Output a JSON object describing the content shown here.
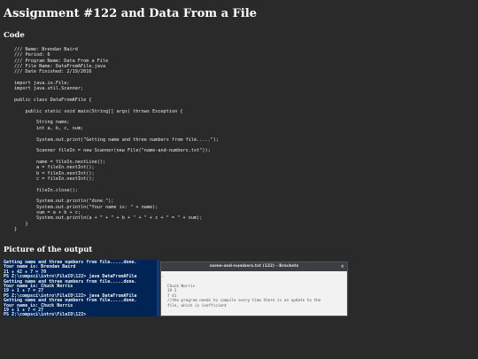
{
  "page": {
    "title": "Assignment #122 and Data From a File"
  },
  "sections": {
    "code_heading": "Code",
    "output_heading": "Picture of the output"
  },
  "code": {
    "lines": [
      "/// Name: Brendan Baird",
      "/// Period: 6",
      "/// Program Name: Data From a File",
      "/// File Name: DataFromAFile.java",
      "/// Date Finished: 2/19/2016",
      "",
      "import java.io.File;",
      "import java.util.Scanner;",
      "",
      "public class DataFromAFile {",
      "",
      "    public static void main(String[] args) throws Exception {",
      "",
      "        String name;",
      "        int a, b, c, sum;",
      "",
      "        System.out.print(\"Getting name and three numbers from file.....\");",
      "",
      "        Scanner fileIn = new Scanner(new File(\"name-and-numbers.txt\"));",
      "",
      "        name = fileIn.nextLine();",
      "        a = fileIn.nextInt();",
      "        b = fileIn.nextInt();",
      "        c = fileIn.nextInt();",
      "",
      "        fileIn.close();",
      "",
      "        System.out.println(\"done.\");",
      "        System.out.println(\"Your name is: \" + name);",
      "        sum = a + b + c;",
      "        System.out.println(a + \" + \" + b + \" + \" + c + \" = \" + sum);",
      "    }",
      "}"
    ]
  },
  "terminal": {
    "lines": [
      "Getting name and three numbers from file.....done.",
      "Your name is: Brendan Baird",
      "21 + 42 + 7 = 70",
      "PS Z:\\compsci\\intro\\FileIO\\122> java DataFromAFile",
      "Getting name and three numbers from file.....done.",
      "Your name is: Chuck Norris",
      "19 + 1 + 7 = 27",
      "PS Z:\\compsci\\intro\\FileIO\\122> java DataFromAFile",
      "Getting name and three numbers from file.....done.",
      "Your name is: Chuck Norris",
      "19 + 1 + 7 = 27",
      "PS Z:\\compsci\\intro\\FileIO\\122>"
    ]
  },
  "editor": {
    "title": "name-and-numbers.txt (122) - Brackets",
    "close_glyph": "×",
    "gutter_glyph": "›",
    "lines": [
      "Chuck Norris",
      "19 1",
      "7 41",
      "//the program needs to compile every time there is an update to the",
      "file, which is inefficient"
    ]
  },
  "colors": {
    "background": "#2a2a2a",
    "terminal_bg": "#012456",
    "editor_bg": "#f2f2f2",
    "editor_titlebar": "#3c3f41"
  }
}
